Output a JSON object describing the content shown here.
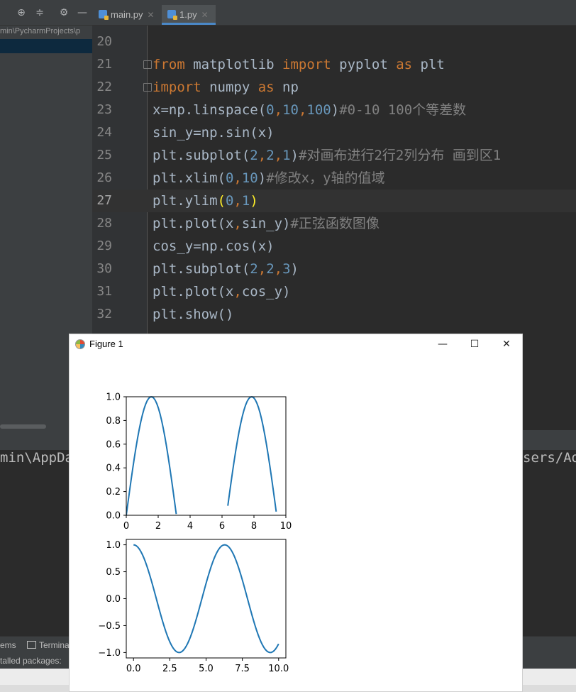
{
  "tabs": [
    {
      "label": "main.py",
      "close": "✕"
    },
    {
      "label": "1.py",
      "close": "✕"
    }
  ],
  "project": {
    "path": "min\\PycharmProjects\\p"
  },
  "code": [
    {
      "n": "20",
      "html": ""
    },
    {
      "n": "21",
      "html": "<span class=\"kw\">from</span> matplotlib <span class=\"kw\">import</span> pyplot <span class=\"kw\">as</span> plt"
    },
    {
      "n": "22",
      "html": "<span class=\"kw\">import</span> numpy <span class=\"kw\">as</span> np"
    },
    {
      "n": "23",
      "html": "x=np.linspace(<span class=\"num\">0</span><span class=\"pn\">,</span><span class=\"num\">10</span><span class=\"pn\">,</span><span class=\"num\">100</span>)<span class=\"cm\">#0-10 100个等差数</span>"
    },
    {
      "n": "24",
      "html": "sin_y=np.sin(x)"
    },
    {
      "n": "25",
      "html": "plt.subplot(<span class=\"num\">2</span><span class=\"pn\">,</span><span class=\"num\">2</span><span class=\"pn\">,</span><span class=\"num\">1</span>)<span class=\"cm\">#对画布进行2行2列分布 画到区1</span>"
    },
    {
      "n": "26",
      "html": "plt.xlim(<span class=\"num\">0</span><span class=\"pn\">,</span><span class=\"num\">10</span>)<span class=\"cm\">#修改x，y轴的值域</span>"
    },
    {
      "n": "27",
      "html": "plt.ylim<span class=\"br\">(</span><span class=\"num\">0</span><span class=\"pn\">,</span><span class=\"num\">1</span><span class=\"br\">)</span>",
      "current": true
    },
    {
      "n": "28",
      "html": "plt.plot(x<span class=\"pn\">,</span>sin_y)<span class=\"cm\">#正弦函数图像</span>"
    },
    {
      "n": "29",
      "html": "cos_y=np.cos(x)"
    },
    {
      "n": "30",
      "html": "plt.subplot(<span class=\"num\">2</span><span class=\"pn\">,</span><span class=\"num\">2</span><span class=\"pn\">,</span><span class=\"num\">3</span>)"
    },
    {
      "n": "31",
      "html": "plt.plot(x<span class=\"pn\">,</span>cos_y)"
    },
    {
      "n": "32",
      "html": "plt.show()"
    }
  ],
  "terminal": {
    "left_text": "min\\AppDa",
    "right_text": "sers/Ad"
  },
  "bottom": {
    "problems": "ems",
    "terminal": "Termina",
    "status": "talled packages:"
  },
  "figure": {
    "title": "Figure 1",
    "minimize": "—",
    "maximize": "☐",
    "close": "✕",
    "line_color": "#1f77b4"
  },
  "chart_data": [
    {
      "type": "line",
      "series": [
        {
          "function": "sin",
          "x_range": [
            0,
            10
          ],
          "points": 100
        }
      ],
      "xlim": [
        0,
        10
      ],
      "ylim": [
        0,
        1
      ],
      "xticks": [
        "0",
        "2",
        "4",
        "6",
        "8",
        "10"
      ],
      "yticks": [
        "0.0",
        "0.2",
        "0.4",
        "0.6",
        "0.8",
        "1.0"
      ]
    },
    {
      "type": "line",
      "series": [
        {
          "function": "cos",
          "x_range": [
            0,
            10
          ],
          "points": 100
        }
      ],
      "xlim": [
        -0.5,
        10.5
      ],
      "ylim": [
        -1.1,
        1.1
      ],
      "xticks": [
        "0.0",
        "2.5",
        "5.0",
        "7.5",
        "10.0"
      ],
      "yticks": [
        "−1.0",
        "−0.5",
        "0.0",
        "0.5",
        "1.0"
      ]
    }
  ]
}
